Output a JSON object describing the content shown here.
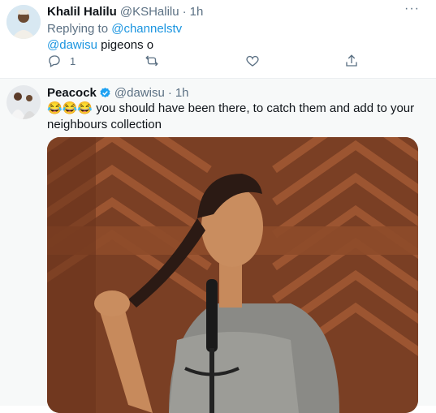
{
  "tweet1": {
    "author_name": "Khalil Halilu",
    "handle": "@KSHalilu",
    "separator": "·",
    "time": "1h",
    "replying_prefix": "Replying to",
    "replying_to": "@channelstv",
    "mention": "@dawisu",
    "text": " pigeons o",
    "reply_count": "1",
    "more_icon": "more-icon"
  },
  "tweet2": {
    "author_name": "Peacock",
    "handle": "@dawisu",
    "separator": "·",
    "time": "1h",
    "emojis": "😂😂😂",
    "text_line1": " you should have been there, to catch them and add to your",
    "text_line2": "neighbours collection"
  },
  "colors": {
    "link": "#1b95e0",
    "muted": "#5b7083",
    "verified": "#1da1f2"
  }
}
